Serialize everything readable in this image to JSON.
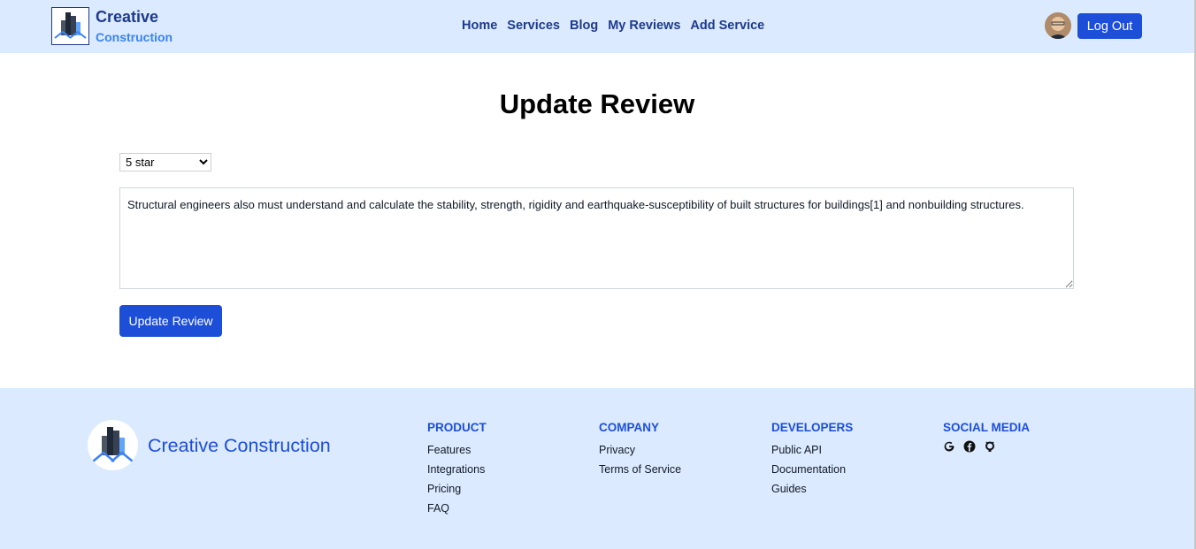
{
  "header": {
    "brand_line1": "Creative",
    "brand_line2": "Construction",
    "nav": [
      "Home",
      "Services",
      "Blog",
      "My Reviews",
      "Add Service"
    ],
    "logout_label": "Log Out"
  },
  "main": {
    "title": "Update Review",
    "rating_selected": "5 star",
    "review_text": "Structural engineers also must understand and calculate the stability, strength, rigidity and earthquake-susceptibility of built structures for buildings[1] and nonbuilding structures.",
    "submit_label": "Update Review"
  },
  "footer": {
    "brand": "Creative Construction",
    "columns": [
      {
        "heading": "PRODUCT",
        "links": [
          "Features",
          "Integrations",
          "Pricing",
          "FAQ"
        ]
      },
      {
        "heading": "COMPANY",
        "links": [
          "Privacy",
          "Terms of Service"
        ]
      },
      {
        "heading": "DEVELOPERS",
        "links": [
          "Public API",
          "Documentation",
          "Guides"
        ]
      },
      {
        "heading": "SOCIAL MEDIA",
        "icons": [
          "google-icon",
          "facebook-icon",
          "github-icon"
        ]
      }
    ]
  },
  "colors": {
    "accent": "#1d4ed8",
    "header_bg": "#dbeafe",
    "brand_dark": "#1e3a8a"
  }
}
